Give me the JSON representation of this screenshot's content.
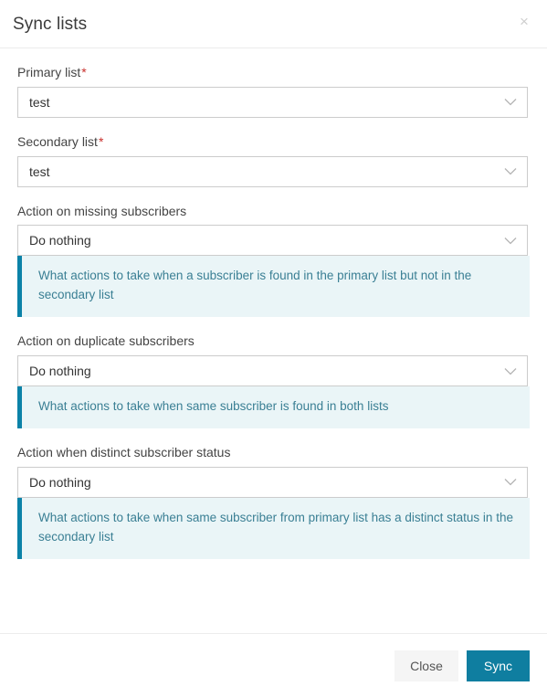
{
  "modal": {
    "title": "Sync lists",
    "close_icon": "close-icon",
    "close_glyph": "×"
  },
  "form": {
    "fields": [
      {
        "label": "Primary list",
        "required": true,
        "required_marker": "*",
        "value": "test",
        "chevron_icon": "chevron-down-icon",
        "info": null
      },
      {
        "label": "Secondary list",
        "required": true,
        "required_marker": "*",
        "value": "test",
        "chevron_icon": "chevron-down-icon",
        "info": null
      },
      {
        "label": "Action on missing subscribers",
        "required": false,
        "required_marker": "",
        "value": "Do nothing",
        "chevron_icon": "chevron-down-icon",
        "info": "What actions to take when a subscriber is found in the primary list but not in the secondary list"
      },
      {
        "label": "Action on duplicate subscribers",
        "required": false,
        "required_marker": "",
        "value": "Do nothing",
        "chevron_icon": "chevron-down-icon",
        "info": "What actions to take when same subscriber is found in both lists"
      },
      {
        "label": "Action when distinct subscriber status",
        "required": false,
        "required_marker": "",
        "value": "Do nothing",
        "chevron_icon": "chevron-down-icon",
        "info": "What actions to take when same subscriber from primary list has a distinct status in the secondary list"
      }
    ]
  },
  "footer": {
    "close_label": "Close",
    "sync_label": "Sync"
  },
  "colors": {
    "accent": "#0f7ea0",
    "alert_bar": "#0b82a8",
    "alert_bg": "#eaf5f7",
    "alert_text": "#3a7f94",
    "required": "#c9302c",
    "border": "#cccccc",
    "divider": "#ececec",
    "close_button_bg": "#f5f5f5"
  }
}
